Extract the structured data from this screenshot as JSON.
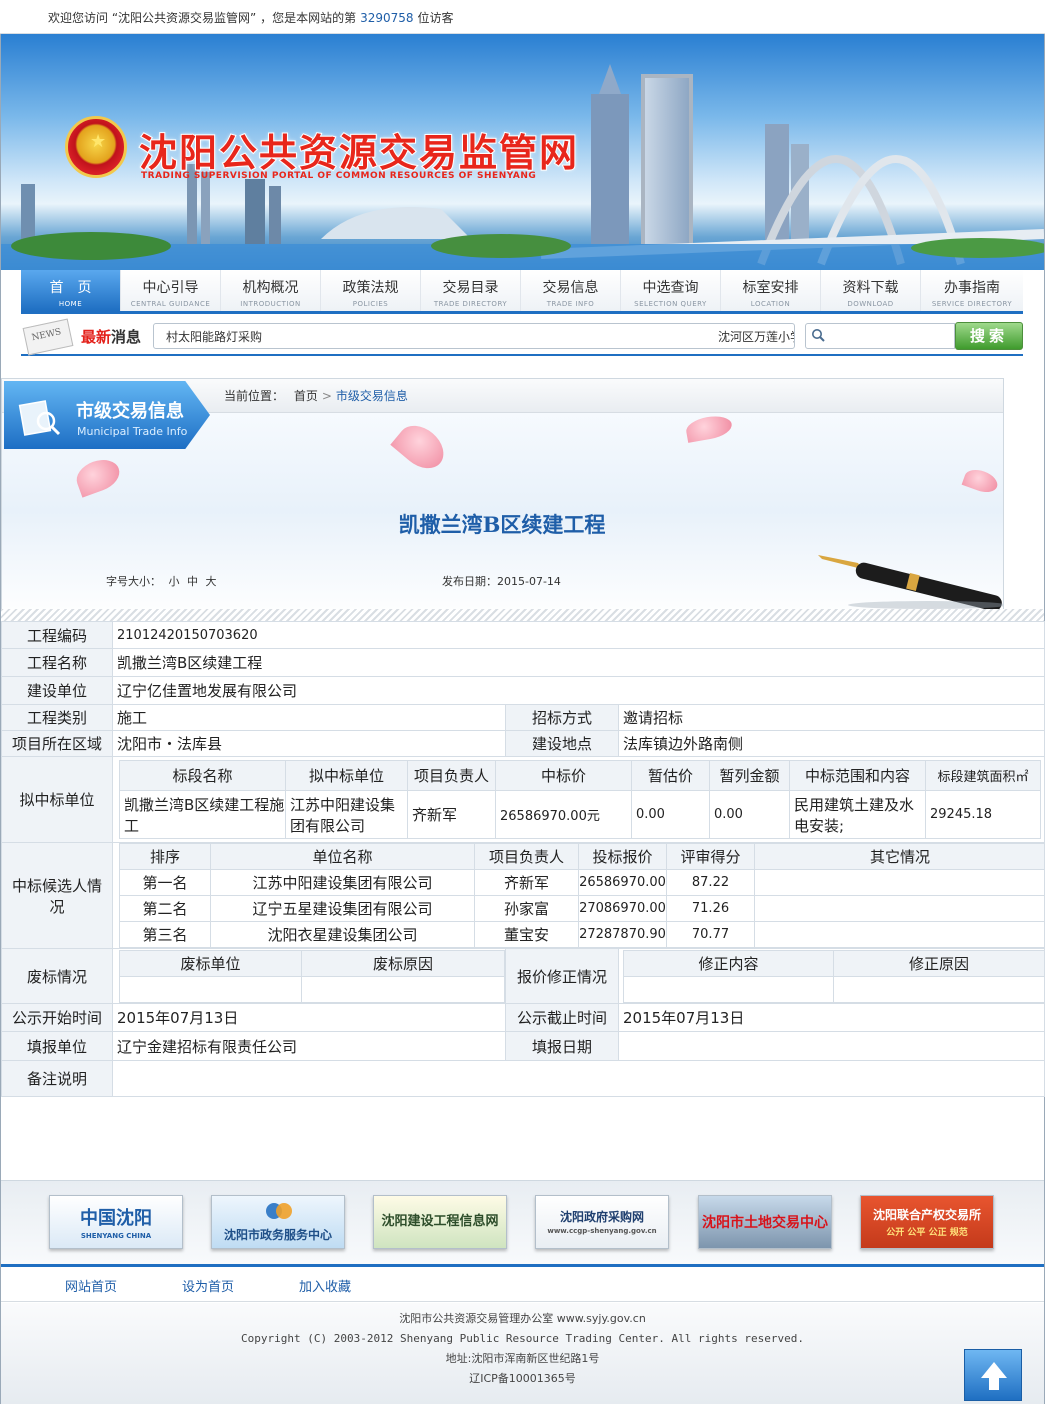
{
  "topbar": {
    "welcome_prefix": "欢迎您访问 “沈阳公共资源交易监管网” ，您是本网站的第",
    "visit_count": "3290758",
    "welcome_suffix": "位访客"
  },
  "banner": {
    "title": "沈阳公共资源交易监管网",
    "subtitle": "TRADING SUPERVISION PORTAL OF COMMON RESOURCES OF SHENYANG"
  },
  "nav": [
    {
      "cn": "首　页",
      "en": "HOME",
      "active": true
    },
    {
      "cn": "中心引导",
      "en": "CENTRAL GUIDANCE"
    },
    {
      "cn": "机构概况",
      "en": "INTRODUCTION"
    },
    {
      "cn": "政策法规",
      "en": "POLICIES"
    },
    {
      "cn": "交易目录",
      "en": "TRADE DIRECTORY"
    },
    {
      "cn": "交易信息",
      "en": "TRADE INFO"
    },
    {
      "cn": "中选查询",
      "en": "SELECTION QUERY"
    },
    {
      "cn": "标室安排",
      "en": "LOCATION"
    },
    {
      "cn": "资料下载",
      "en": "DOWNLOAD"
    },
    {
      "cn": "办事指南",
      "en": "SERVICE DIRECTORY"
    }
  ],
  "news": {
    "icon_text": "NEWS",
    "label_hot": "最新",
    "label_rest": "消息",
    "items": [
      "村太阳能路灯采购",
      "沈河区万莲小学"
    ]
  },
  "search": {
    "placeholder": "",
    "button_label": "搜索"
  },
  "section": {
    "title_cn": "市级交易信息",
    "title_en": "Municipal Trade Info"
  },
  "breadcrumb": {
    "prefix": "当前位置：",
    "home": "首页",
    "sep": ">",
    "current": "市级交易信息"
  },
  "article": {
    "title": "凯撒兰湾B区续建工程",
    "font_size_label": "字号大小：",
    "font_sizes": [
      "小",
      "中",
      "大"
    ],
    "pub_date_label": "发布日期：",
    "pub_date": "2015-07-14"
  },
  "detail": {
    "project_code_label": "工程编码",
    "project_code": "21012420150703620",
    "project_name_label": "工程名称",
    "project_name": "凯撒兰湾B区续建工程",
    "builder_label": "建设单位",
    "builder": "辽宁亿佳置地发展有限公司",
    "category_label": "工程类别",
    "category": "施工",
    "bid_method_label": "招标方式",
    "bid_method": "邀请招标",
    "region_label": "项目所在区域",
    "region": "沈阳市・法库县",
    "site_label": "建设地点",
    "site": "法库镇边外路南侧",
    "winner_label": "拟中标单位",
    "winner_headers": [
      "标段名称",
      "拟中标单位",
      "项目负责人",
      "中标价",
      "暂估价",
      "暂列金额",
      "中标范围和内容",
      "标段建筑面积㎡"
    ],
    "winner_row": [
      "凯撒兰湾B区续建工程施工",
      "江苏中阳建设集团有限公司",
      "齐新军",
      "26586970.00元",
      "0.00",
      "0.00",
      "民用建筑土建及水电安装;",
      "29245.18"
    ],
    "candidates_label": "中标候选人情况",
    "candidate_headers": [
      "排序",
      "单位名称",
      "项目负责人",
      "投标报价",
      "评审得分",
      "其它情况"
    ],
    "candidates": [
      [
        "第一名",
        "江苏中阳建设集团有限公司",
        "齐新军",
        "26586970.00",
        "87.22",
        ""
      ],
      [
        "第二名",
        "辽宁五星建设集团有限公司",
        "孙家富",
        "27086970.00",
        "71.26",
        ""
      ],
      [
        "第三名",
        "沈阳衣星建设集团公司",
        "董宝安",
        "27287870.90",
        "70.77",
        ""
      ]
    ],
    "void_label": "废标情况",
    "void_headers": [
      "废标单位",
      "废标原因"
    ],
    "price_fix_label": "报价修正情况",
    "price_fix_headers": [
      "修正内容",
      "修正原因"
    ],
    "notice_start_label": "公示开始时间",
    "notice_start": "2015年07月13日",
    "notice_end_label": "公示截止时间",
    "notice_end": "2015年07月13日",
    "filer_label": "填报单位",
    "filer": "辽宁金建招标有限责任公司",
    "file_date_label": "填报日期",
    "file_date": "",
    "remark_label": "备注说明",
    "remark": ""
  },
  "partners": [
    {
      "label": "中国沈阳",
      "sub": "SHENYANG CHINA"
    },
    {
      "label": "沈阳市政务服务中心",
      "sub": ""
    },
    {
      "label": "沈阳建设工程信息网",
      "sub": ""
    },
    {
      "label": "沈阳政府采购网",
      "sub": "www.ccgp-shenyang.gov.cn"
    },
    {
      "label": "沈阳市土地交易中心",
      "sub": ""
    },
    {
      "label": "沈阳联合产权交易所",
      "sub": "公开 公平 公正 规范"
    }
  ],
  "bottom_nav": [
    "网站首页",
    "设为首页",
    "加入收藏"
  ],
  "footer": {
    "office": "沈阳市公共资源交易管理办公室 www.syjy.gov.cn",
    "copyright": "Copyright (C) 2003-2012 Shenyang Public Resource Trading Center. All rights reserved.",
    "address": "地址:沈阳市浑南新区世纪路1号",
    "icp": "辽ICP备10001365号"
  },
  "colors": {
    "brand_blue": "#1f6fc2",
    "title_red": "#e8261b",
    "link_blue": "#1f5ea8"
  }
}
